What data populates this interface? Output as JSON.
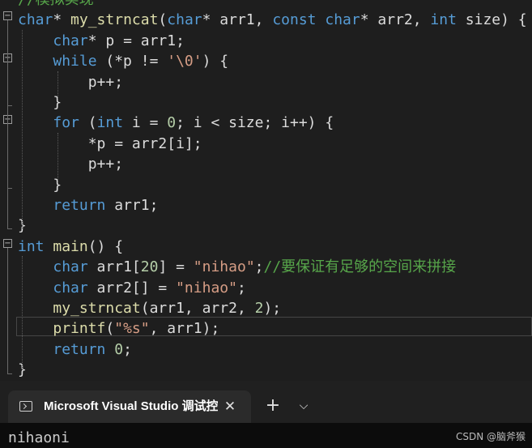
{
  "editor": {
    "lines": [
      [
        {
          "t": "//模拟实现",
          "c": "cm"
        }
      ],
      [
        {
          "t": "char",
          "c": "kw"
        },
        {
          "t": "* ",
          "c": "p"
        },
        {
          "t": "my_strncat",
          "c": "fn"
        },
        {
          "t": "(",
          "c": "p"
        },
        {
          "t": "char",
          "c": "kw"
        },
        {
          "t": "* arr1, ",
          "c": "p"
        },
        {
          "t": "const",
          "c": "kw"
        },
        {
          "t": " ",
          "c": "p"
        },
        {
          "t": "char",
          "c": "kw"
        },
        {
          "t": "* arr2, ",
          "c": "p"
        },
        {
          "t": "int",
          "c": "kw"
        },
        {
          "t": " size) {",
          "c": "p"
        }
      ],
      [
        {
          "t": "    ",
          "c": "p"
        },
        {
          "t": "char",
          "c": "kw"
        },
        {
          "t": "* p = arr1;",
          "c": "p"
        }
      ],
      [
        {
          "t": "    ",
          "c": "p"
        },
        {
          "t": "while",
          "c": "kw"
        },
        {
          "t": " (*p != ",
          "c": "p"
        },
        {
          "t": "'\\0'",
          "c": "str"
        },
        {
          "t": ") {",
          "c": "p"
        }
      ],
      [
        {
          "t": "        p++;",
          "c": "p"
        }
      ],
      [
        {
          "t": "    }",
          "c": "p"
        }
      ],
      [
        {
          "t": "    ",
          "c": "p"
        },
        {
          "t": "for",
          "c": "kw"
        },
        {
          "t": " (",
          "c": "p"
        },
        {
          "t": "int",
          "c": "kw"
        },
        {
          "t": " i = ",
          "c": "p"
        },
        {
          "t": "0",
          "c": "num"
        },
        {
          "t": "; i < size; i++) {",
          "c": "p"
        }
      ],
      [
        {
          "t": "        *p = arr2[i];",
          "c": "p"
        }
      ],
      [
        {
          "t": "        p++;",
          "c": "p"
        }
      ],
      [
        {
          "t": "    }",
          "c": "p"
        }
      ],
      [
        {
          "t": "    ",
          "c": "p"
        },
        {
          "t": "return",
          "c": "kw"
        },
        {
          "t": " arr1;",
          "c": "p"
        }
      ],
      [
        {
          "t": "}",
          "c": "p"
        }
      ],
      [
        {
          "t": "int",
          "c": "kw"
        },
        {
          "t": " ",
          "c": "p"
        },
        {
          "t": "main",
          "c": "fn"
        },
        {
          "t": "() {",
          "c": "p"
        }
      ],
      [
        {
          "t": "    ",
          "c": "p"
        },
        {
          "t": "char",
          "c": "kw"
        },
        {
          "t": " arr1[",
          "c": "p"
        },
        {
          "t": "20",
          "c": "num"
        },
        {
          "t": "] = ",
          "c": "p"
        },
        {
          "t": "\"nihao\"",
          "c": "str"
        },
        {
          "t": ";",
          "c": "p"
        },
        {
          "t": "//要保证有足够的空间来拼接",
          "c": "cm"
        }
      ],
      [
        {
          "t": "    ",
          "c": "p"
        },
        {
          "t": "char",
          "c": "kw"
        },
        {
          "t": " arr2[] = ",
          "c": "p"
        },
        {
          "t": "\"nihao\"",
          "c": "str"
        },
        {
          "t": ";",
          "c": "p"
        }
      ],
      [
        {
          "t": "    ",
          "c": "p"
        },
        {
          "t": "my_strncat",
          "c": "fn"
        },
        {
          "t": "(arr1, arr2, ",
          "c": "p"
        },
        {
          "t": "2",
          "c": "num"
        },
        {
          "t": ");",
          "c": "p"
        }
      ],
      [
        {
          "t": "    ",
          "c": "p"
        },
        {
          "t": "printf",
          "c": "fn"
        },
        {
          "t": "(",
          "c": "p"
        },
        {
          "t": "\"%s\"",
          "c": "str"
        },
        {
          "t": ", arr1);",
          "c": "p"
        }
      ],
      [
        {
          "t": "    ",
          "c": "p"
        },
        {
          "t": "return",
          "c": "kw"
        },
        {
          "t": " ",
          "c": "p"
        },
        {
          "t": "0",
          "c": "num"
        },
        {
          "t": ";",
          "c": "p"
        }
      ],
      [
        {
          "t": "}",
          "c": "p"
        }
      ]
    ]
  },
  "terminal": {
    "tab_title": "Microsoft Visual Studio 调试控制台",
    "close_glyph": "✕",
    "new_tab_glyph": "+",
    "dropdown_glyph": "⌵",
    "output": "nihaoni"
  },
  "watermark": "CSDN @脑斧猴",
  "colors": {
    "keyword": "#569cd6",
    "function": "#dcdcaa",
    "string": "#d69d85",
    "comment": "#57a64a",
    "number": "#b5cea8",
    "editor_bg": "#1e1e1e",
    "terminal_bg": "#0c0c0c"
  }
}
